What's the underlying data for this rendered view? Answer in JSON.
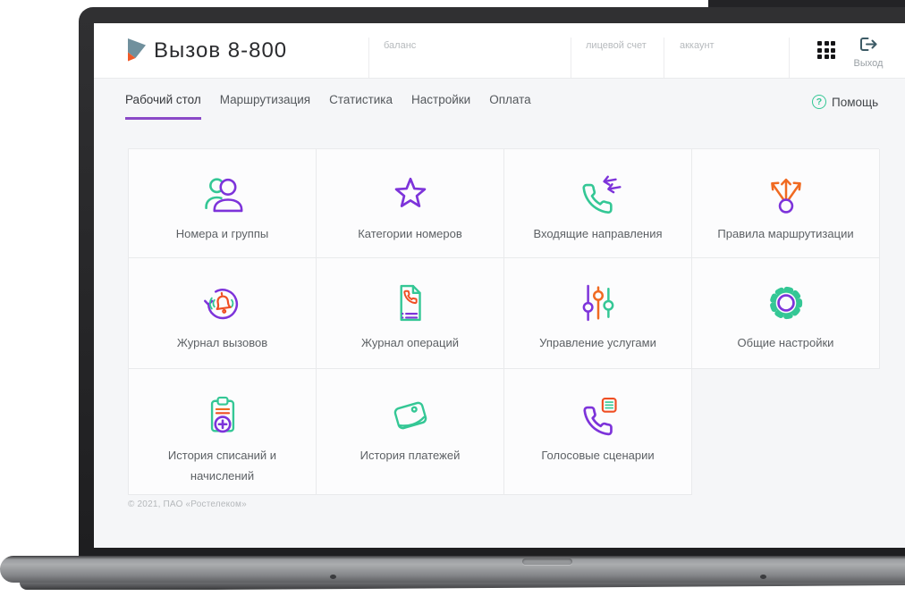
{
  "header": {
    "logo_text": "Вызов 8-800",
    "fields": [
      {
        "label": "баланс"
      },
      {
        "label": "лицевой счет"
      },
      {
        "label": "аккаунт"
      }
    ],
    "apps_icon": "grid-icon",
    "logout": {
      "icon": "logout-icon",
      "label": "Выход"
    }
  },
  "nav": {
    "tabs": [
      {
        "label": "Рабочий стол",
        "active": true
      },
      {
        "label": "Маршрутизация",
        "active": false
      },
      {
        "label": "Статистика",
        "active": false
      },
      {
        "label": "Настройки",
        "active": false
      },
      {
        "label": "Оплата",
        "active": false
      }
    ],
    "help": {
      "icon": "help-question-icon",
      "label": "Помощь"
    }
  },
  "cards": [
    {
      "icon": "users-icon",
      "label": "Номера и группы"
    },
    {
      "icon": "star-icon",
      "label": "Категории номеров"
    },
    {
      "icon": "phone-incoming-icon",
      "label": "Входящие направления"
    },
    {
      "icon": "route-split-icon",
      "label": "Правила маршрутизации"
    },
    {
      "icon": "bell-redial-icon",
      "label": "Журнал вызовов"
    },
    {
      "icon": "phone-document-icon",
      "label": "Журнал операций"
    },
    {
      "icon": "sliders-icon",
      "label": "Управление услугами"
    },
    {
      "icon": "gear-icon",
      "label": "Общие настройки"
    },
    {
      "icon": "clipboard-plus-icon",
      "label": "История списаний и начислений"
    },
    {
      "icon": "wallet-icon",
      "label": "История платежей"
    },
    {
      "icon": "phone-script-icon",
      "label": "Голосовые сценарии"
    }
  ],
  "footer": {
    "copyright": "© 2021, ПАО «Ростелеком»"
  },
  "colors": {
    "accent_purple": "#7d33da",
    "accent_green": "#34c795",
    "accent_orange": "#f06a21",
    "accent_red": "#ef4e23",
    "tab_underline": "#8a49c7",
    "logo_slate": "#70909d",
    "logo_orange": "#f05a28"
  }
}
